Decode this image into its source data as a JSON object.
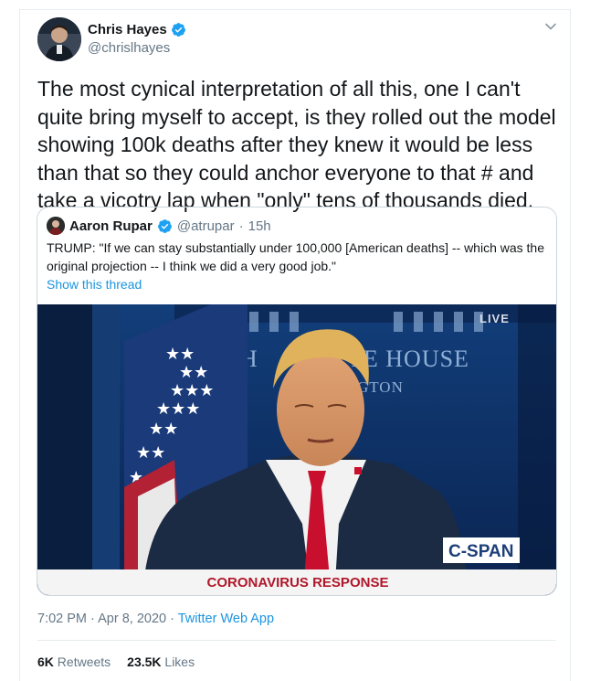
{
  "tweet": {
    "author_name": "Chris Hayes",
    "author_handle": "@chrislhayes",
    "text": "The most cynical interpretation of all this, one I can't quite bring myself to accept, is they rolled out the model showing 100k deaths after they knew it would be less than that so they could anchor everyone to that # and take a vicotry lap when \"only\" tens of thousands died.",
    "time": "7:02 PM",
    "date": "Apr 8, 2020",
    "separator": "·",
    "source": "Twitter Web App",
    "retweets_count": "6K",
    "retweets_label": "Retweets",
    "likes_count": "23.5K",
    "likes_label": "Likes"
  },
  "quoted": {
    "author_name": "Aaron Rupar",
    "author_handle": "@atrupar",
    "age": "15h",
    "text": "TRUMP: \"If we can stay substantially under 100,000 [American deaths] -- which was the original projection -- I think we did a very good job.\"",
    "show_thread": "Show this thread",
    "video": {
      "live_badge": "LIVE",
      "backdrop_line1": "TE HOUSE",
      "backdrop_line1_left": "TH",
      "backdrop_line2": "INGTON",
      "network_logo": "C-SPAN",
      "banner": "CORONAVIRUS RESPONSE"
    }
  },
  "icons": {
    "verified": "verified-badge-icon",
    "caret": "chevron-down-icon"
  },
  "colors": {
    "link": "#1b95e0",
    "verified": "#1da1f2",
    "secondary_text": "#657786"
  }
}
